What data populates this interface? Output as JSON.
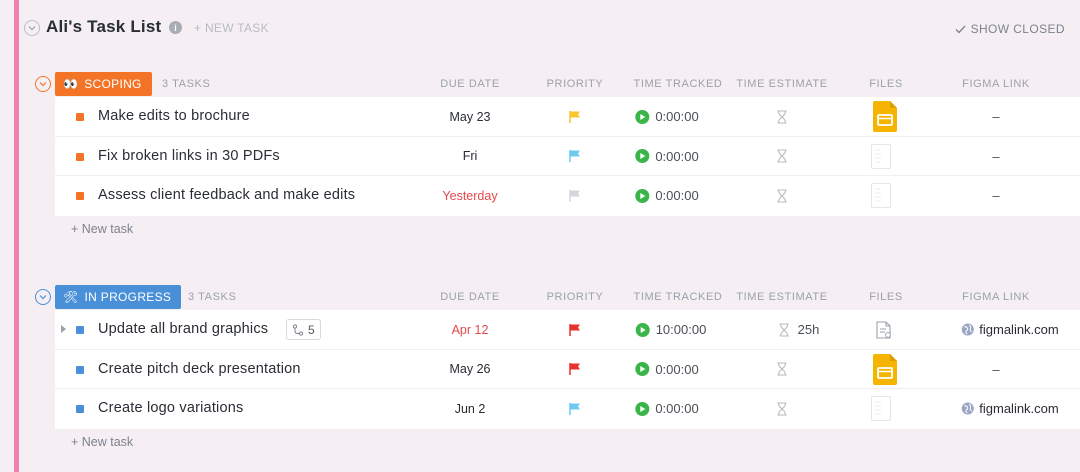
{
  "list": {
    "title": "Ali's Task List",
    "info_icon": "i",
    "new_task_label": "+ NEW TASK",
    "show_closed_label": "SHOW CLOSED"
  },
  "columns": {
    "due_date": "DUE DATE",
    "priority": "PRIORITY",
    "time_tracked": "TIME TRACKED",
    "time_estimate": "TIME ESTIMATE",
    "files": "FILES",
    "figma_link": "FIGMA LINK"
  },
  "colors": {
    "accent": "#f27fae",
    "scoping": "#f37327",
    "in_progress": "#4a90d9",
    "flag_yellow": "#f8c630",
    "flag_cyan": "#6fc8ef",
    "flag_gray": "#d3d6da",
    "flag_red": "#e5322d",
    "timer_green": "#3ab54a",
    "due_red": "#e5484d"
  },
  "groups": [
    {
      "status": "SCOPING",
      "emoji": "👀",
      "count_label": "3 TASKS",
      "add_task_label": "+ New task",
      "tasks": [
        {
          "name": "Make edits to brochure",
          "due": "May 23",
          "due_red": false,
          "priority": "flag_yellow",
          "time": "0:00:00",
          "estimate": "",
          "file": "slides-icon",
          "figma": "–"
        },
        {
          "name": "Fix broken links in 30 PDFs",
          "due": "Fri",
          "due_red": false,
          "priority": "flag_cyan",
          "time": "0:00:00",
          "estimate": "",
          "file": "blank-file-icon",
          "figma": "–"
        },
        {
          "name": "Assess client feedback and make edits",
          "due": "Yesterday",
          "due_red": true,
          "priority": "flag_gray",
          "time": "0:00:00",
          "estimate": "",
          "file": "blank-file-icon",
          "figma": "–"
        }
      ]
    },
    {
      "status": "IN PROGRESS",
      "emoji": "🛠",
      "count_label": "3 TASKS",
      "add_task_label": "+ New task",
      "tasks": [
        {
          "name": "Update all brand graphics",
          "subtasks": "5",
          "due": "Apr 12",
          "due_red": true,
          "priority": "flag_red",
          "time": "10:00:00",
          "estimate": "25h",
          "file": "doc-icon",
          "figma": "figmalink.com"
        },
        {
          "name": "Create pitch deck presentation",
          "due": "May 26",
          "due_red": false,
          "priority": "flag_red",
          "time": "0:00:00",
          "estimate": "",
          "file": "slides-icon",
          "figma": "–"
        },
        {
          "name": "Create logo variations",
          "due": "Jun 2",
          "due_red": false,
          "priority": "flag_cyan",
          "time": "0:00:00",
          "estimate": "",
          "file": "blank-file-icon",
          "figma": "figmalink.com"
        }
      ]
    }
  ]
}
